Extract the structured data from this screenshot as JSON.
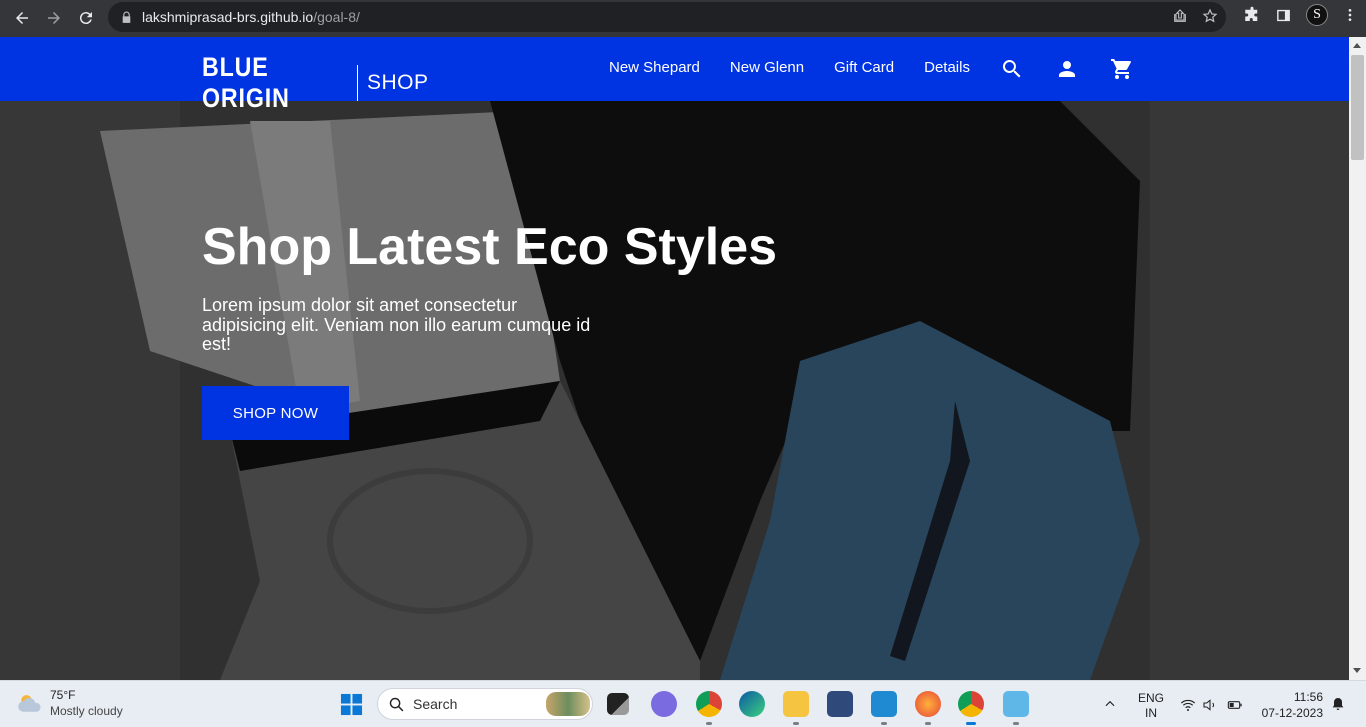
{
  "browser": {
    "url_host": "lakshmiprasad-brs.github.io",
    "url_path": "/goal-8/",
    "profile_initial": "S"
  },
  "site": {
    "logo_text": "BLUE ORIGIN",
    "logo_sub": "SHOP",
    "nav": [
      "New Shepard",
      "New Glenn",
      "Gift Card",
      "Details"
    ],
    "brand_color": "#0033e1"
  },
  "hero": {
    "title": "Shop Latest Eco Styles",
    "text": "Lorem ipsum dolor sit amet consectetur adipisicing elit. Veniam non illo earum cumque id est!",
    "cta": "SHOP NOW"
  },
  "taskbar": {
    "weather_temp": "75°F",
    "weather_desc": "Mostly cloudy",
    "search_label": "Search",
    "lang_line1": "ENG",
    "lang_line2": "IN",
    "time": "11:56",
    "date": "07-12-2023"
  }
}
